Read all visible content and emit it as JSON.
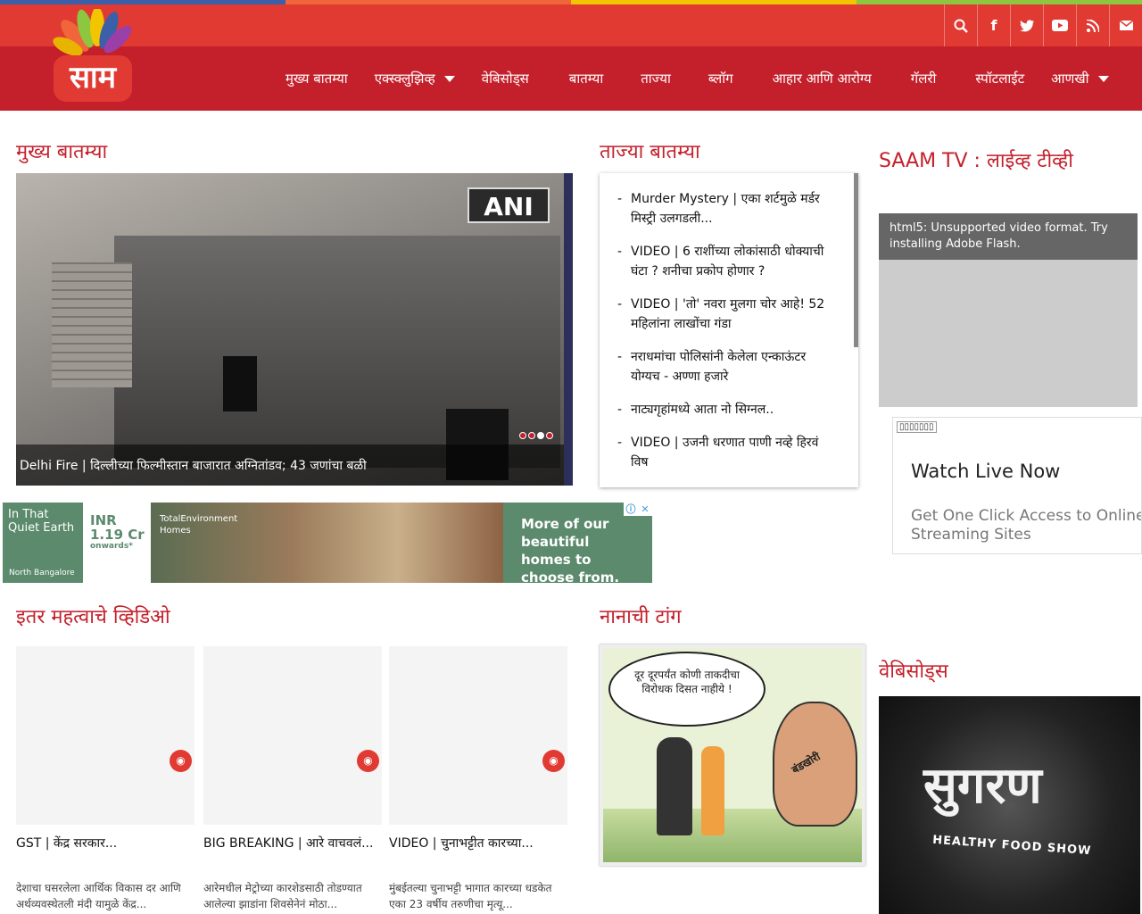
{
  "colors": {
    "strip": [
      "#3b5fa8",
      "#f0663a",
      "#f2c500",
      "#8dc63f"
    ],
    "topbar": "#e03a33",
    "navbar": "#c4202b",
    "accent": "#c4202b"
  },
  "header": {
    "logo_text": "साम",
    "social_icons": [
      "search-icon",
      "facebook-icon",
      "twitter-icon",
      "youtube-icon",
      "rss-icon",
      "mail-icon"
    ],
    "nav": [
      {
        "label": "मुख्य बातम्या",
        "dropdown": false
      },
      {
        "label": "एक्स्क्लुझिव्ह",
        "dropdown": true
      },
      {
        "label": "वेबिसोड्स",
        "dropdown": false
      },
      {
        "label": "बातम्या",
        "dropdown": false
      },
      {
        "label": "ताज्या",
        "dropdown": false
      },
      {
        "label": "ब्लॉग",
        "dropdown": false
      },
      {
        "label": "आहार आणि आरोग्य",
        "dropdown": false
      },
      {
        "label": "गॅलरी",
        "dropdown": false
      },
      {
        "label": "स्पॉटलाईट",
        "dropdown": false
      },
      {
        "label": "आणखी",
        "dropdown": true
      }
    ]
  },
  "main_news": {
    "title": "मुख्य बातम्या",
    "slide_logo": "ANI",
    "caption": "Delhi Fire | दिल्लीच्या फिल्मीस्तान बाजारात अग्नितांडव; 43 जणांचा बळी",
    "dots": 4,
    "active_dot": 2
  },
  "latest": {
    "title": "ताज्या बातम्या",
    "items": [
      "Murder Mystery | एका शर्टमुळे मर्डर मिस्ट्री उलगडली...",
      "VIDEO | 6 राशींच्या लोकांसाठी धोक्याची घंटा ? शनीचा प्रकोप होणार ?",
      "VIDEO | 'तो' नवरा मुलगा चोर आहे! 52 महिलांना लाखोंचा गंडा",
      "नराधमांचा पोलिसांनी केलेला एन्काऊंटर योग्यच - अण्णा हजारे",
      "नाट्यगृहांमध्ये आता नो सिग्नल..",
      "VIDEO | उजनी धरणात पाणी नव्हे हिरवं विष"
    ]
  },
  "live": {
    "title": "SAAM TV : लाईव्ह टीव्ही",
    "video_message": "html5: Unsupported video format. Try installing Adobe Flash.",
    "ad_badge": "▯▯▯▯▯▯▯",
    "ad_heading": "Watch Live Now",
    "ad_sub": "Get One Click Access to Online Streaming Sites"
  },
  "ad_banner": {
    "left_text": "In That Quiet Earth",
    "left_sub": "North Bangalore",
    "price": "INR 1.19 Cr",
    "price_note": "onwards*",
    "brand": "TotalEnvironment Homes",
    "right_text": "More of our beautiful homes to choose from.",
    "info_icon": "ⓘ",
    "close_icon": "✕"
  },
  "videos": {
    "title": "इतर महत्वाचे व्हिडिओ",
    "items": [
      {
        "title": "GST | केंद्र सरकार...",
        "desc": "देशाचा घसरलेला आर्थिक विकास दर आणि अर्थव्यवस्थेतली मंदी यामुळे केंद्र..."
      },
      {
        "title": "BIG BREAKING | आरे वाचवलं...",
        "desc": "आरेमधील मेट्रोच्या कारशेडसाठी तोडण्यात आलेल्या झाडांना शिवसेनेनं मोठा..."
      },
      {
        "title": "VIDEO | चुनाभट्टीत कारच्या...",
        "desc": "मुंबईतल्या चुनाभट्टी भागात कारच्या धडकेत एका 23 वर्षीय तरुणीचा मृत्यू..."
      }
    ]
  },
  "cartoon": {
    "title": "नानाची टांग",
    "bubble": "दूर दूरपर्यंत कोणी ताकदीचा विरोधक दिसत नाहीये !",
    "label": "बंडखोरी"
  },
  "webisodes": {
    "title": "वेबिसोड्स",
    "show_name": "सुगरण",
    "show_sub": "HEALTHY FOOD SHOW"
  }
}
